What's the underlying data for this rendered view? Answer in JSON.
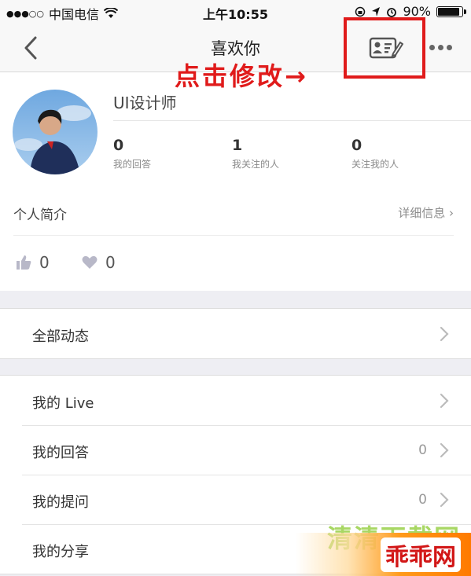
{
  "status_bar": {
    "signal": "●●●○○",
    "carrier": "中国电信",
    "time": "上午10:55",
    "battery_text": "90%",
    "battery_level": 0.9
  },
  "nav": {
    "title": "喜欢你",
    "back_icon": "chevron-left-icon",
    "card_icon": "edit-profile-card-icon",
    "more_icon": "more-dots-icon"
  },
  "annotation": {
    "text": "点击修改→",
    "color": "#e01b1b"
  },
  "profile": {
    "username": "UI设计师",
    "stats": [
      {
        "value": "0",
        "label": "我的回答"
      },
      {
        "value": "1",
        "label": "我关注的人"
      },
      {
        "value": "0",
        "label": "关注我的人"
      }
    ],
    "intro_label": "个人简介",
    "intro_detail": "详细信息 ›",
    "likes": "0",
    "hearts": "0"
  },
  "lists": {
    "group1": [
      {
        "label": "全部动态",
        "count": ""
      }
    ],
    "group2": [
      {
        "label": "我的 Live",
        "count": ""
      },
      {
        "label": "我的回答",
        "count": "0"
      },
      {
        "label": "我的提问",
        "count": "0"
      },
      {
        "label": "我的分享",
        "count": ""
      }
    ]
  },
  "watermark": {
    "site": "清清下载网",
    "brand": "乖乖网"
  }
}
